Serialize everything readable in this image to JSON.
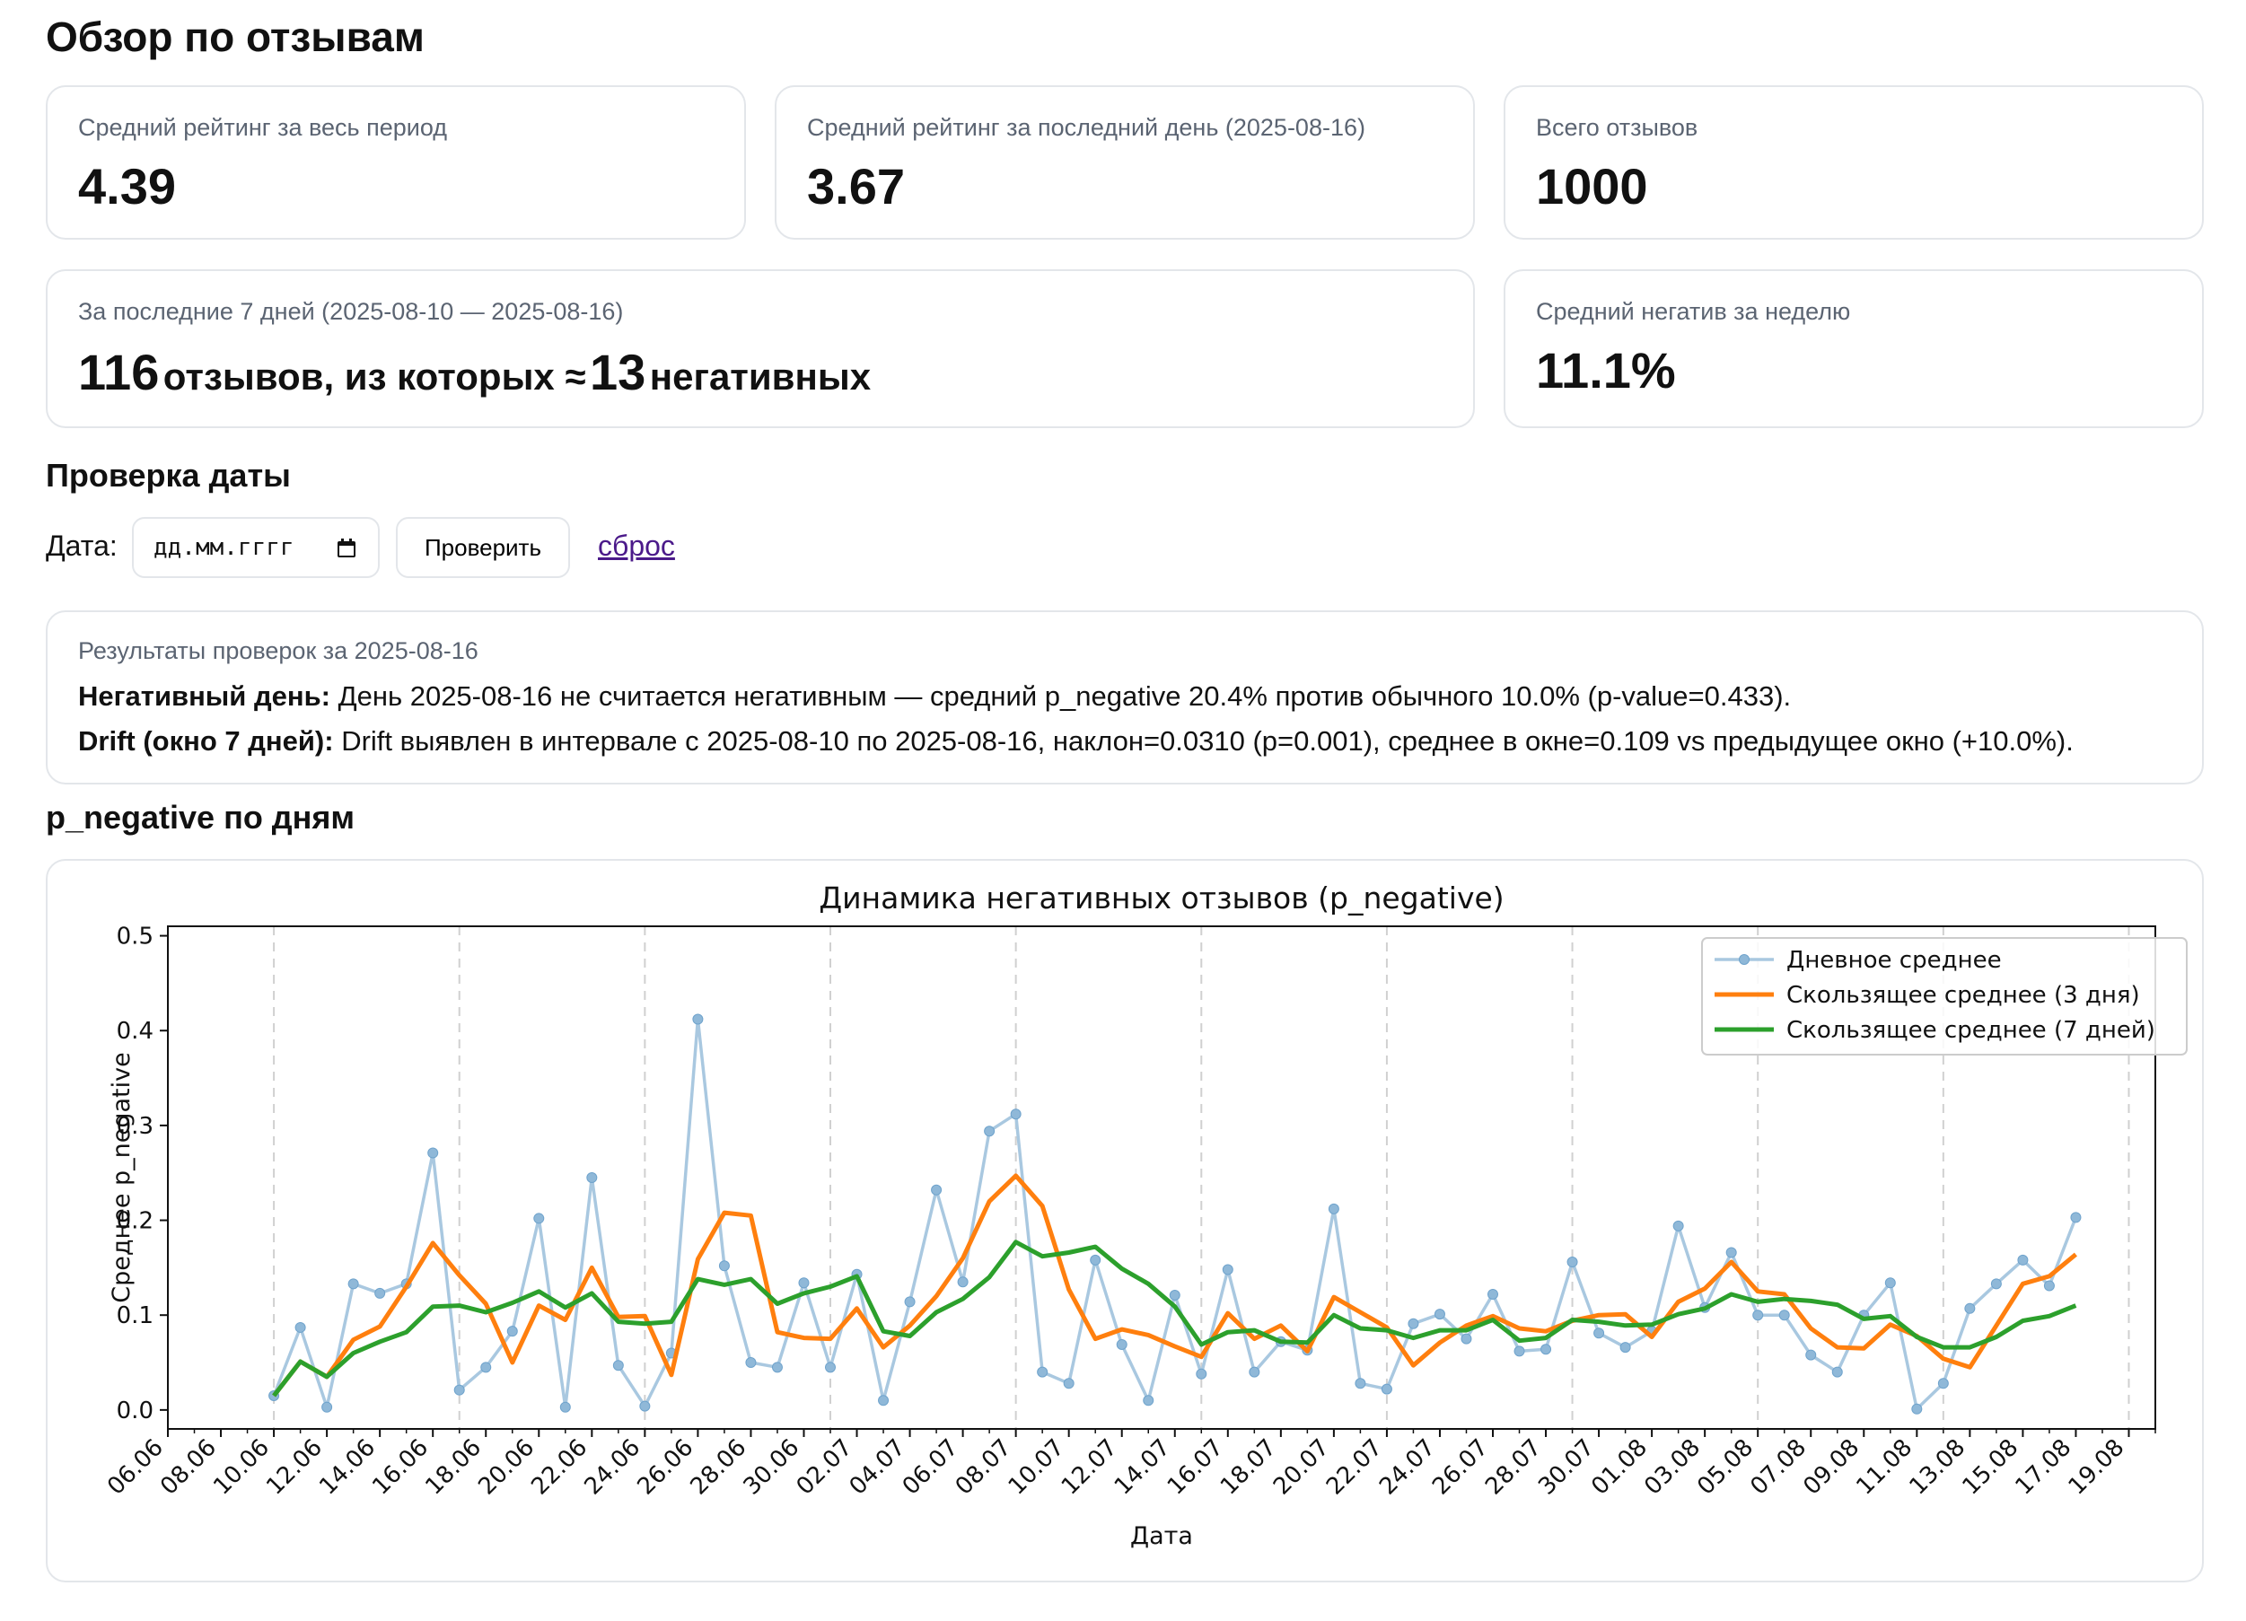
{
  "page": {
    "title": "Обзор по отзывам"
  },
  "cards": {
    "avg_all": {
      "label": "Средний рейтинг за весь период",
      "value": "4.39"
    },
    "avg_last_day": {
      "label": "Средний рейтинг за последний день (2025-08-16)",
      "value": "3.67"
    },
    "total": {
      "label": "Всего отзывов",
      "value": "1000"
    },
    "week": {
      "label": "За последние 7 дней (2025-08-10 — 2025-08-16)",
      "count": "116",
      "text1": "отзывов, из которых ≈",
      "neg_count": "13",
      "text2": "негативных"
    },
    "neg_week": {
      "label": "Средний негатив за неделю",
      "value": "11.1%"
    }
  },
  "date_check": {
    "title": "Проверка даты",
    "label": "Дата:",
    "input_placeholder": "дд.мм.гггг",
    "button": "Проверить",
    "reset": "сброс"
  },
  "results": {
    "title": "Результаты проверок за 2025-08-16",
    "neg_label": "Негативный день:",
    "neg_text": "День 2025-08-16 не считается негативным — средний p_negative 20.4% против обычного 10.0% (p-value=0.433).",
    "drift_label": "Drift (окно 7 дней):",
    "drift_text": "Drift выявлен в интервале с 2025-08-10 по 2025-08-16, наклон=0.0310 (p=0.001), среднее в окне=0.109 vs предыдущее окно (+10.0%)."
  },
  "chart_section": {
    "title": "p_negative по дням"
  },
  "chart_data": {
    "type": "line",
    "title": "Динамика негативных отзывов (p_negative)",
    "xlabel": "Дата",
    "ylabel": "Среднее p_negative",
    "ylim": [
      -0.02,
      0.51
    ],
    "yticks": [
      0.0,
      0.1,
      0.2,
      0.3,
      0.4,
      0.5
    ],
    "ytick_labels": [
      "0.0",
      "0.1",
      "0.2",
      "0.3",
      "0.4",
      "0.5"
    ],
    "x_start": "2025-06-09",
    "x_end": "2025-08-16",
    "xlim": [
      "2025-06-05",
      "2025-08-19"
    ],
    "xtick_labels": [
      "06.06",
      "08.06",
      "10.06",
      "12.06",
      "14.06",
      "16.06",
      "18.06",
      "20.06",
      "22.06",
      "24.06",
      "26.06",
      "28.06",
      "30.06",
      "02.07",
      "04.07",
      "06.07",
      "08.07",
      "10.07",
      "12.07",
      "14.07",
      "16.07",
      "18.07",
      "20.07",
      "22.07",
      "24.07",
      "26.07",
      "28.07",
      "30.07",
      "01.08",
      "03.08",
      "05.08",
      "07.08",
      "09.08",
      "11.08",
      "13.08",
      "15.08",
      "17.08",
      "19.08"
    ],
    "weekly_grid": [
      "2025-06-09",
      "2025-06-16",
      "2025-06-23",
      "2025-06-30",
      "2025-07-07",
      "2025-07-14",
      "2025-07-21",
      "2025-07-28",
      "2025-08-04",
      "2025-08-11",
      "2025-08-18"
    ],
    "legend_position": "top-right",
    "series": [
      {
        "name": "Дневное среднее",
        "color": "#a9c8e0",
        "marker": true,
        "values": [
          0.015,
          0.087,
          0.003,
          0.133,
          0.123,
          0.133,
          0.271,
          0.021,
          0.045,
          0.083,
          0.202,
          0.003,
          0.245,
          0.047,
          0.004,
          0.06,
          0.412,
          0.152,
          0.05,
          0.045,
          0.134,
          0.045,
          0.143,
          0.01,
          0.114,
          0.232,
          0.135,
          0.294,
          0.312,
          0.04,
          0.028,
          0.158,
          0.069,
          0.01,
          0.121,
          0.038,
          0.148,
          0.04,
          0.072,
          0.063,
          0.212,
          0.028,
          0.022,
          0.091,
          0.101,
          0.075,
          0.122,
          0.062,
          0.064,
          0.156,
          0.081,
          0.066,
          0.083,
          0.194,
          0.108,
          0.166,
          0.1,
          0.1,
          0.058,
          0.04,
          0.1,
          0.134,
          0.001,
          0.028,
          0.107,
          0.133,
          0.158,
          0.131,
          0.203
        ]
      },
      {
        "name": "Скользящее среднее (3 дня)",
        "color": "#ff7f0e",
        "values": [
          0.015,
          0.051,
          0.035,
          0.074,
          0.088,
          0.13,
          0.176,
          0.142,
          0.112,
          0.05,
          0.11,
          0.095,
          0.15,
          0.098,
          0.099,
          0.037,
          0.159,
          0.208,
          0.205,
          0.082,
          0.076,
          0.075,
          0.107,
          0.066,
          0.089,
          0.12,
          0.16,
          0.22,
          0.247,
          0.215,
          0.127,
          0.075,
          0.085,
          0.079,
          0.067,
          0.056,
          0.102,
          0.075,
          0.089,
          0.062,
          0.119,
          0.103,
          0.087,
          0.047,
          0.071,
          0.089,
          0.099,
          0.086,
          0.083,
          0.094,
          0.1,
          0.101,
          0.077,
          0.114,
          0.128,
          0.156,
          0.125,
          0.122,
          0.086,
          0.066,
          0.065,
          0.09,
          0.078,
          0.054,
          0.045,
          0.089,
          0.133,
          0.141,
          0.164
        ]
      },
      {
        "name": "Скользящее среднее (7 дней)",
        "color": "#2ca02c",
        "values": [
          0.015,
          0.051,
          0.035,
          0.06,
          0.072,
          0.082,
          0.109,
          0.11,
          0.103,
          0.113,
          0.125,
          0.108,
          0.123,
          0.093,
          0.091,
          0.093,
          0.138,
          0.132,
          0.138,
          0.112,
          0.123,
          0.13,
          0.141,
          0.083,
          0.078,
          0.103,
          0.117,
          0.14,
          0.177,
          0.162,
          0.166,
          0.172,
          0.149,
          0.133,
          0.109,
          0.069,
          0.082,
          0.084,
          0.072,
          0.071,
          0.1,
          0.086,
          0.084,
          0.076,
          0.084,
          0.084,
          0.095,
          0.073,
          0.076,
          0.095,
          0.093,
          0.089,
          0.09,
          0.101,
          0.107,
          0.122,
          0.114,
          0.117,
          0.115,
          0.111,
          0.096,
          0.099,
          0.077,
          0.066,
          0.066,
          0.077,
          0.094,
          0.099,
          0.11
        ]
      }
    ]
  }
}
